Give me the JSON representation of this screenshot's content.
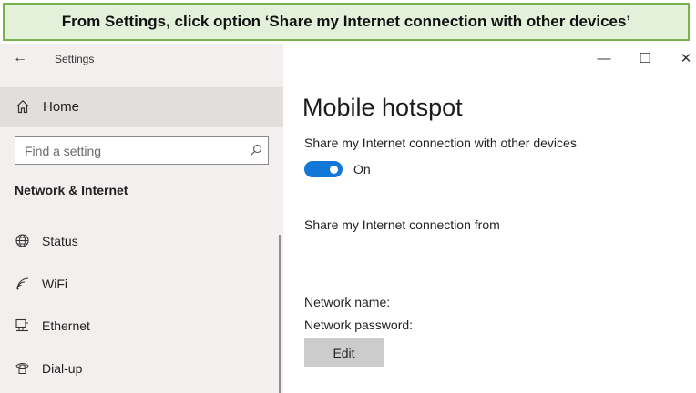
{
  "banner": {
    "text": "From Settings, click option ‘Share my Internet connection with other devices’"
  },
  "window": {
    "title": "Settings",
    "minimize_glyph": "—",
    "maximize_glyph": "☐",
    "close_glyph": "✕"
  },
  "sidebar": {
    "back_glyph": "←",
    "home_label": "Home",
    "search_placeholder": "Find a setting",
    "section_title": "Network & Internet",
    "items": [
      {
        "label": "Status",
        "icon": "globe-icon"
      },
      {
        "label": "WiFi",
        "icon": "wifi-icon"
      },
      {
        "label": "Ethernet",
        "icon": "ethernet-icon"
      },
      {
        "label": "Dial-up",
        "icon": "dialup-icon"
      }
    ]
  },
  "main": {
    "title": "Mobile hotspot",
    "share_label": "Share my Internet connection with other devices",
    "toggle_state": "On",
    "share_from_label": "Share my Internet connection from",
    "network_name_label": "Network name:",
    "network_password_label": "Network password:",
    "edit_label": "Edit"
  },
  "colors": {
    "banner_bg": "#e3f0da",
    "banner_border": "#79b14f",
    "sidebar_bg": "#f3efee",
    "toggle_on": "#1277d6",
    "edit_button_bg": "#cccccc"
  }
}
